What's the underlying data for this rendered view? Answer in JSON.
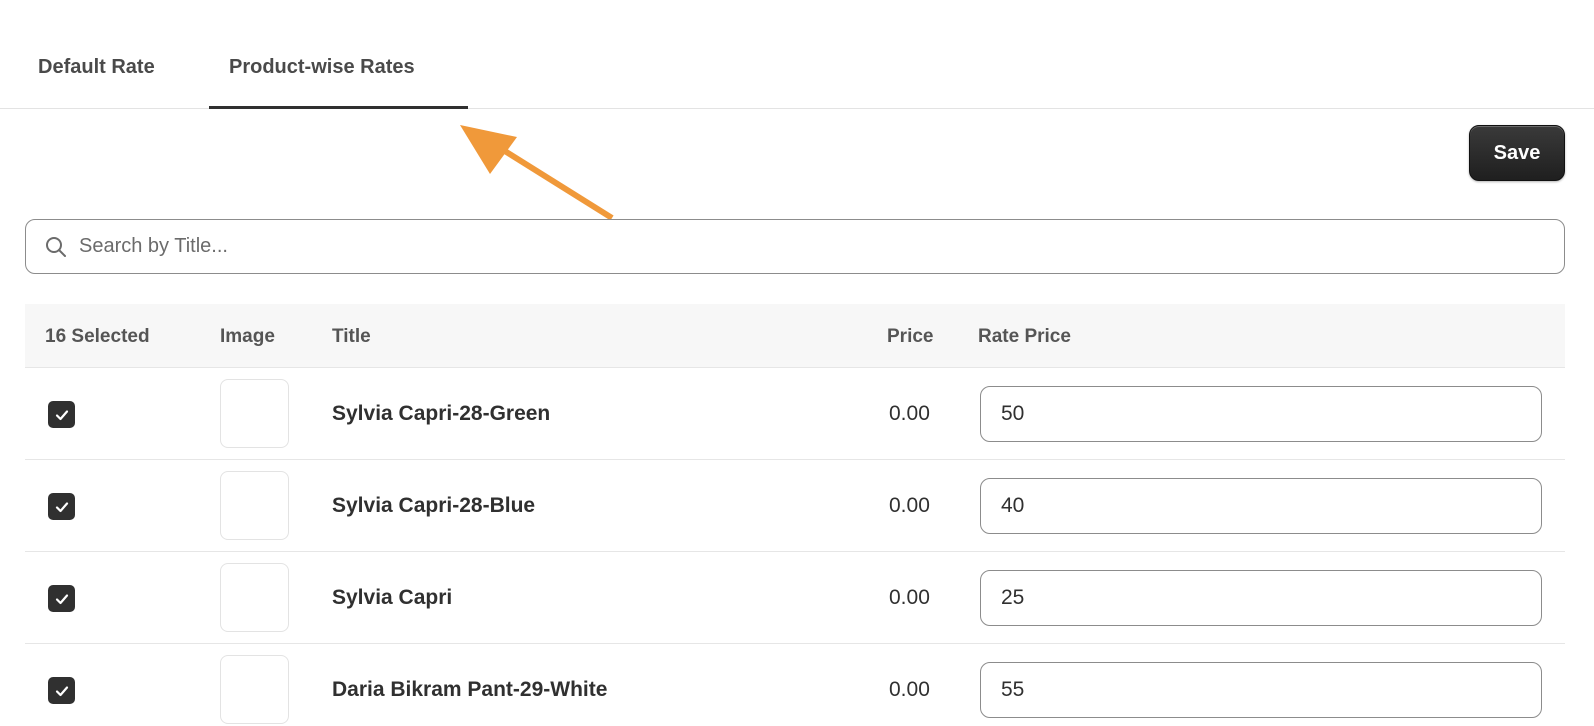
{
  "tabs": [
    {
      "label": "Default Rate",
      "active": false
    },
    {
      "label": "Product-wise Rates",
      "active": true
    }
  ],
  "toolbar": {
    "save_label": "Save"
  },
  "search": {
    "placeholder": "Search by Title...",
    "value": ""
  },
  "table": {
    "headers": {
      "selected": "16 Selected",
      "image": "Image",
      "title": "Title",
      "price": "Price",
      "rate_price": "Rate Price"
    },
    "rows": [
      {
        "checked": true,
        "title": "Sylvia Capri-28-Green",
        "price": "0.00",
        "rate_price": "50"
      },
      {
        "checked": true,
        "title": "Sylvia Capri-28-Blue",
        "price": "0.00",
        "rate_price": "40"
      },
      {
        "checked": true,
        "title": "Sylvia Capri",
        "price": "0.00",
        "rate_price": "25"
      },
      {
        "checked": true,
        "title": "Daria Bikram Pant-29-White",
        "price": "0.00",
        "rate_price": "55"
      }
    ]
  },
  "colors": {
    "accent": "#303030",
    "annotation_arrow": "#f0993a"
  },
  "icons": {
    "search": "search-icon",
    "checkbox": "check-icon",
    "arrow": "arrow-annotation"
  }
}
